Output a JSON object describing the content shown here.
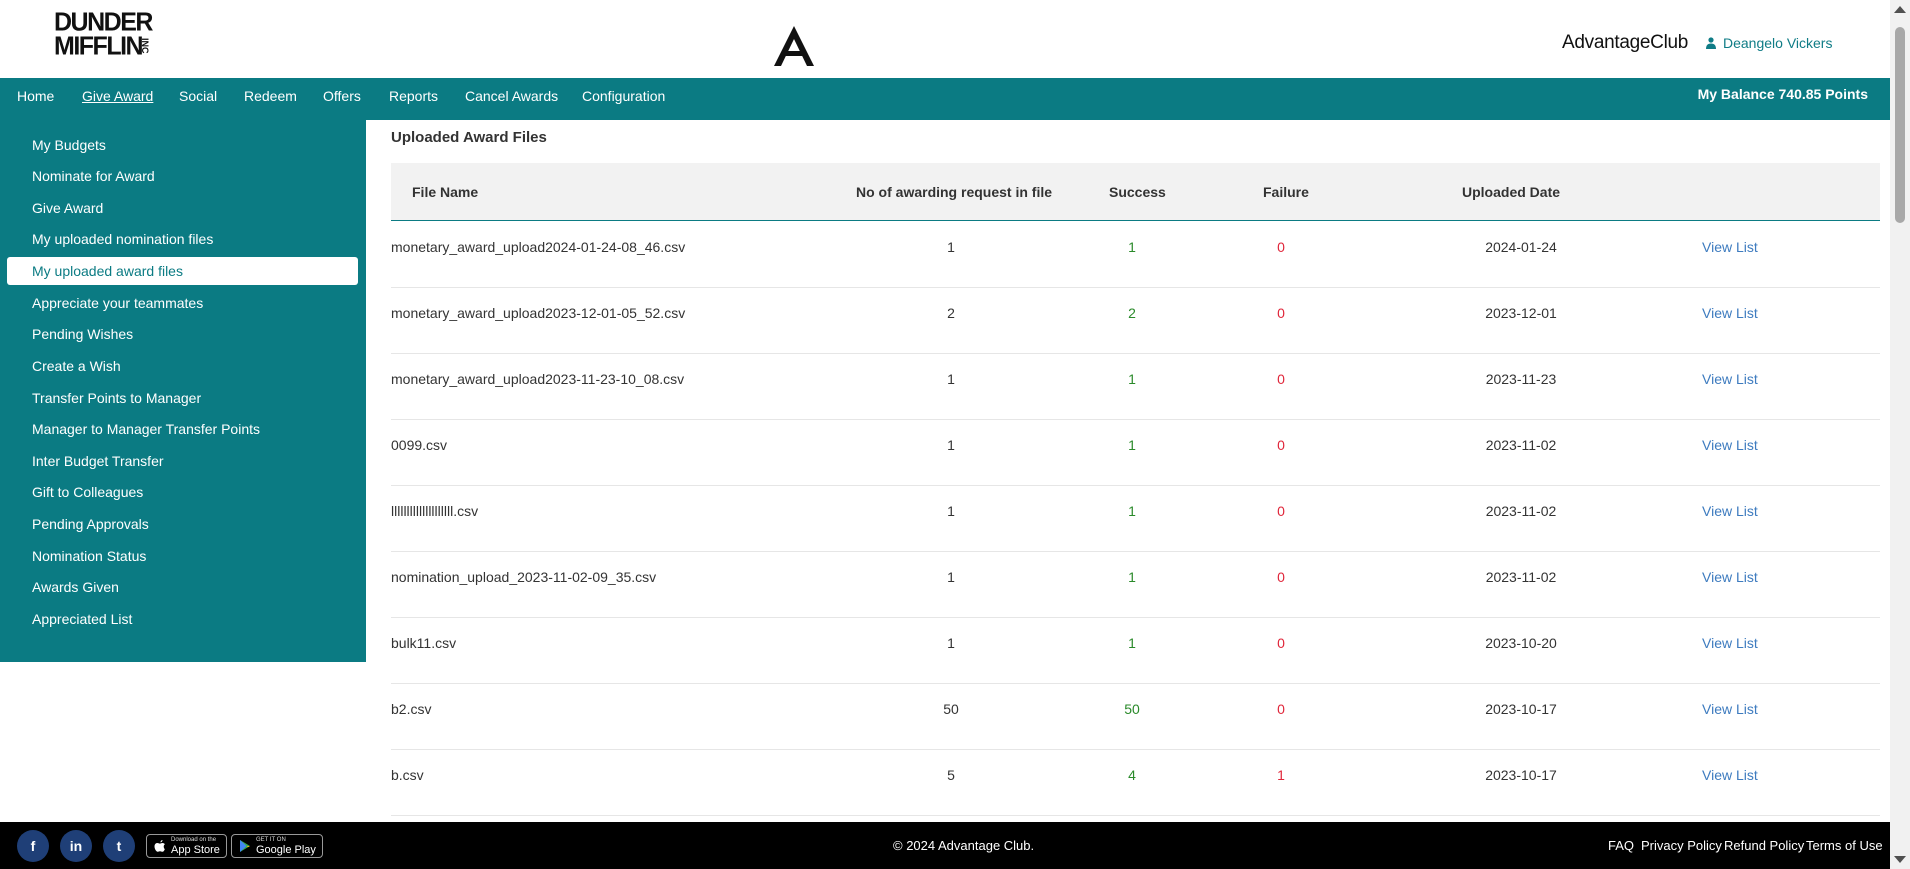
{
  "header": {
    "logo_line1": "DUNDER",
    "logo_line2": "MIFFLIN",
    "logo_suffix": "INC",
    "brand_name": "AdvantageClub",
    "user_name": "Deangelo Vickers",
    "balance": "My Balance 740.85 Points"
  },
  "nav": {
    "items": [
      {
        "label": "Home"
      },
      {
        "label": "Give Award"
      },
      {
        "label": "Social"
      },
      {
        "label": "Redeem"
      },
      {
        "label": "Offers"
      },
      {
        "label": "Reports"
      },
      {
        "label": "Cancel Awards"
      },
      {
        "label": "Configuration"
      }
    ],
    "active": "Give Award"
  },
  "sidebar": {
    "items": [
      {
        "label": "My Budgets"
      },
      {
        "label": "Nominate for Award"
      },
      {
        "label": "Give Award"
      },
      {
        "label": "My uploaded nomination files"
      },
      {
        "label": "My uploaded award files"
      },
      {
        "label": "Appreciate your teammates"
      },
      {
        "label": "Pending Wishes"
      },
      {
        "label": "Create a Wish"
      },
      {
        "label": "Transfer Points to Manager"
      },
      {
        "label": "Manager to Manager Transfer Points"
      },
      {
        "label": "Inter Budget Transfer"
      },
      {
        "label": "Gift to Colleagues"
      },
      {
        "label": "Pending Approvals"
      },
      {
        "label": "Nomination Status"
      },
      {
        "label": "Awards Given"
      },
      {
        "label": "Appreciated List"
      }
    ],
    "active": "My uploaded award files"
  },
  "main": {
    "title": "Uploaded Award Files",
    "columns": [
      "File Name",
      "No of awarding request in file",
      "Success",
      "Failure",
      "Uploaded Date"
    ],
    "view_label": "View List",
    "rows": [
      {
        "file": "monetary_award_upload2024-01-24-08_46.csv",
        "requests": "1",
        "success": "1",
        "failure": "0",
        "date": "2024-01-24"
      },
      {
        "file": "monetary_award_upload2023-12-01-05_52.csv",
        "requests": "2",
        "success": "2",
        "failure": "0",
        "date": "2023-12-01"
      },
      {
        "file": "monetary_award_upload2023-11-23-10_08.csv",
        "requests": "1",
        "success": "1",
        "failure": "0",
        "date": "2023-11-23"
      },
      {
        "file": "0099.csv",
        "requests": "1",
        "success": "1",
        "failure": "0",
        "date": "2023-11-02"
      },
      {
        "file": "llllllllllllllllllll.csv",
        "requests": "1",
        "success": "1",
        "failure": "0",
        "date": "2023-11-02"
      },
      {
        "file": "nomination_upload_2023-11-02-09_35.csv",
        "requests": "1",
        "success": "1",
        "failure": "0",
        "date": "2023-11-02"
      },
      {
        "file": "bulk11.csv",
        "requests": "1",
        "success": "1",
        "failure": "0",
        "date": "2023-10-20"
      },
      {
        "file": "b2.csv",
        "requests": "50",
        "success": "50",
        "failure": "0",
        "date": "2023-10-17"
      },
      {
        "file": "b.csv",
        "requests": "5",
        "success": "4",
        "failure": "1",
        "date": "2023-10-17"
      }
    ]
  },
  "footer": {
    "social": [
      {
        "icon": "facebook-icon",
        "glyph": "f"
      },
      {
        "icon": "linkedin-icon",
        "glyph": "in"
      },
      {
        "icon": "twitter-icon",
        "glyph": "t"
      }
    ],
    "app_store_small": "Download on the",
    "app_store_big": "App Store",
    "google_play_small": "GET IT ON",
    "google_play_big": "Google Play",
    "copyright": "© 2024 Advantage Club.",
    "links": [
      {
        "label": "FAQ"
      },
      {
        "label": "Privacy Policy"
      },
      {
        "label": "Refund Policy"
      },
      {
        "label": "Terms of Use"
      }
    ]
  },
  "colors": {
    "primary_teal": "#0b7b83",
    "success_green": "#2a8a2a",
    "failure_red": "#e0263a",
    "link_blue": "#3d7bbf",
    "footer_bg": "#000000"
  }
}
